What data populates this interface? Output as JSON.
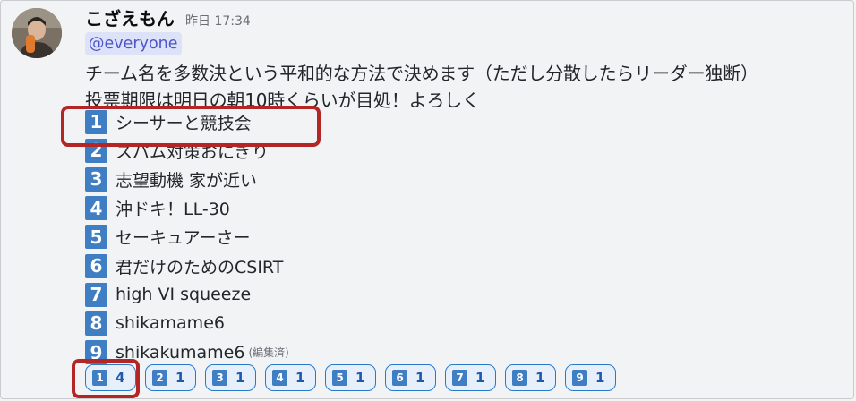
{
  "message": {
    "author": "こざえもん",
    "timestamp": "昨日 17:34",
    "mention": "@everyone",
    "line1": "チーム名を多数決という平和的な方法で決めます（ただし分散したらリーダー独断）",
    "line2": "投票期限は明日の朝10時くらいが目処！よろしく"
  },
  "options": [
    {
      "num": "1",
      "text": "シーサーと競技会"
    },
    {
      "num": "2",
      "text": "スパム対策おにぎり"
    },
    {
      "num": "3",
      "text": "志望動機 家が近い"
    },
    {
      "num": "4",
      "text": "沖ドキ！LL-30"
    },
    {
      "num": "5",
      "text": "セーキュアーさー"
    },
    {
      "num": "6",
      "text": "君だけのためのCSIRT"
    },
    {
      "num": "7",
      "text": "high VI squeeze"
    },
    {
      "num": "8",
      "text": "shikamame6"
    },
    {
      "num": "9",
      "text": "shikakumame6"
    }
  ],
  "edited_label": "(編集済)",
  "reactions": [
    {
      "icon": "1",
      "count": "4"
    },
    {
      "icon": "2",
      "count": "1"
    },
    {
      "icon": "3",
      "count": "1"
    },
    {
      "icon": "4",
      "count": "1"
    },
    {
      "icon": "5",
      "count": "1"
    },
    {
      "icon": "6",
      "count": "1"
    },
    {
      "icon": "7",
      "count": "1"
    },
    {
      "icon": "8",
      "count": "1"
    },
    {
      "icon": "9",
      "count": "1"
    }
  ],
  "colors": {
    "number_badge": "#3f7ec3",
    "highlight": "#b32625",
    "mention_bg": "#dde2f8",
    "mention_text": "#4a56c9"
  }
}
